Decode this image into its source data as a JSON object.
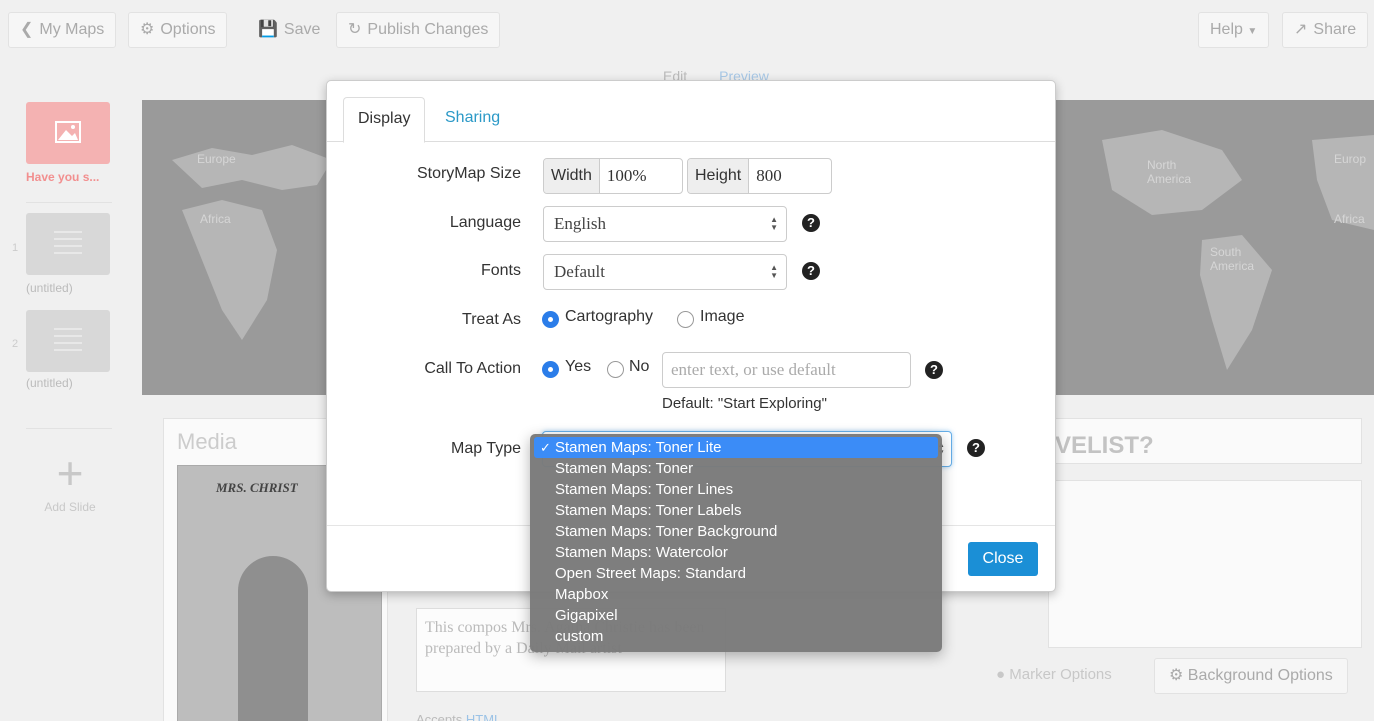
{
  "toolbar": {
    "my_maps": "My Maps",
    "options": "Options",
    "save": "Save",
    "publish": "Publish Changes",
    "help": "Help",
    "share": "Share"
  },
  "view_tabs": {
    "edit": "Edit",
    "preview": "Preview"
  },
  "slides": [
    {
      "num": "",
      "caption": "Have you s..."
    },
    {
      "num": "1",
      "caption": "(untitled)"
    },
    {
      "num": "2",
      "caption": "(untitled)"
    }
  ],
  "add_slide": "Add Slide",
  "map_labels": {
    "europe": "Europe",
    "africa": "Africa",
    "north_america": "North America",
    "south_america": "South America",
    "europe_right": "Europ",
    "africa_right": "Africa"
  },
  "editor": {
    "media_title": "Media",
    "image_caption": "MRS. CHRIST",
    "text_content": "This compos Mrs. Agatha Christie has been prepared by a Daily Mail artist",
    "accepts_label": "Accepts",
    "accepts_link": "HTML",
    "headline_fragment": "VELIST?",
    "marker_options": "Marker Options",
    "background_options": "Background Options"
  },
  "modal": {
    "tabs": [
      "Display",
      "Sharing"
    ],
    "storymap_size": {
      "label": "StoryMap Size",
      "width_label": "Width",
      "width_value": "100%",
      "height_label": "Height",
      "height_value": "800"
    },
    "language": {
      "label": "Language",
      "value": "English"
    },
    "fonts": {
      "label": "Fonts",
      "value": "Default"
    },
    "treat_as": {
      "label": "Treat As",
      "options": [
        "Cartography",
        "Image"
      ],
      "selected": "Cartography"
    },
    "call_to_action": {
      "label": "Call To Action",
      "options": [
        "Yes",
        "No"
      ],
      "selected": "Yes",
      "placeholder": "enter text, or use default",
      "default_text": "Default: \"Start Exploring\""
    },
    "map_type": {
      "label": "Map Type",
      "selected": "Stamen Maps: Toner Lite",
      "options": [
        "Stamen Maps: Toner Lite",
        "Stamen Maps: Toner",
        "Stamen Maps: Toner Lines",
        "Stamen Maps: Toner Labels",
        "Stamen Maps: Toner Background",
        "Stamen Maps: Watercolor",
        "Open Street Maps: Standard",
        "Mapbox",
        "Gigapixel",
        "custom"
      ]
    },
    "close": "Close"
  },
  "colors": {
    "accent": "#1b8fd6",
    "tab_link": "#2b99c7",
    "dropdown_selected": "#3b8cf7",
    "active_slide": "#f4b2b2"
  }
}
